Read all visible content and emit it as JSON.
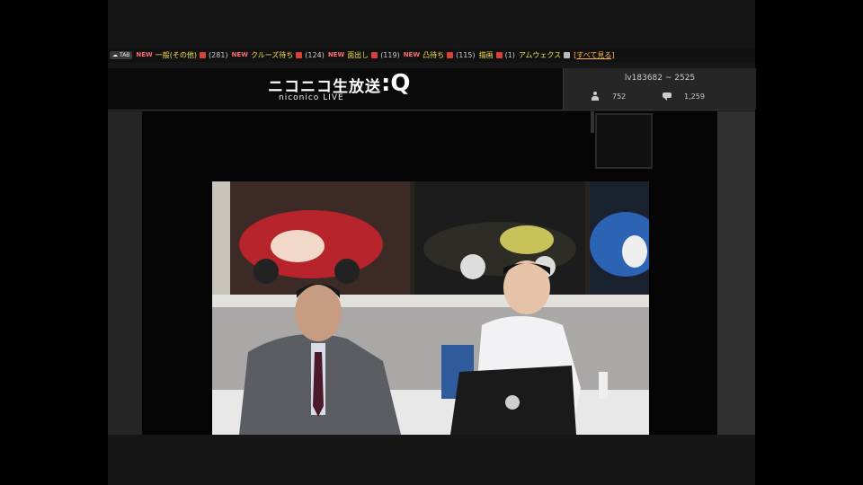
{
  "ticker": {
    "badge": "TAB",
    "items": [
      {
        "tag": "NEW",
        "label": "一般(その他)",
        "count": "(281)"
      },
      {
        "tag": "NEW",
        "label": "クルーズ待ち",
        "count": "(124)"
      },
      {
        "tag": "NEW",
        "label": "面出し",
        "count": "(119)"
      },
      {
        "tag": "NEW",
        "label": "凸待ち",
        "count": "(115)"
      },
      {
        "tag": "",
        "label": "描画",
        "count": "(1)"
      },
      {
        "tag": "",
        "label": "アムウェクス",
        "count": ""
      }
    ],
    "all_link": "[すべて見る]"
  },
  "logo": {
    "main": "ニコニコ生放送",
    "q": ":Q",
    "sub": "niconico LIVE"
  },
  "stats": {
    "live_id": "lv183682 ~ 2525",
    "viewers": "752",
    "comments": "1,259"
  },
  "colors": {
    "accent_red": "#d8403a",
    "accent_yellow": "#f3e04a",
    "link_orange": "#ffb84a"
  }
}
